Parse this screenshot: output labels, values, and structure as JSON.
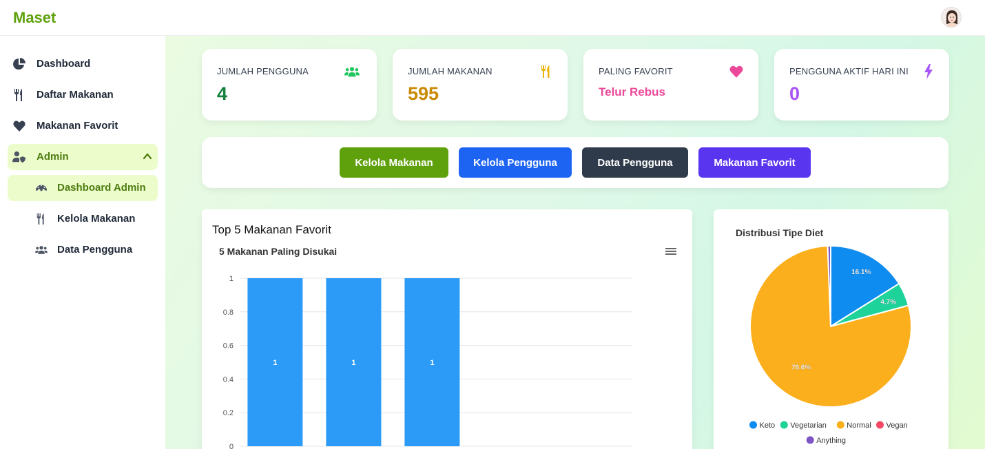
{
  "app": {
    "brand": "Maset"
  },
  "sidebar": {
    "items": [
      {
        "label": "Dashboard",
        "icon": "chart-pie-icon"
      },
      {
        "label": "Daftar Makanan",
        "icon": "utensils-icon"
      },
      {
        "label": "Makanan Favorit",
        "icon": "heart-icon"
      },
      {
        "label": "Admin",
        "icon": "user-shield-icon"
      }
    ],
    "sub_items": [
      {
        "label": "Dashboard Admin",
        "icon": "gauge-icon"
      },
      {
        "label": "Kelola Makanan",
        "icon": "utensils-icon"
      },
      {
        "label": "Data Pengguna",
        "icon": "users-icon"
      }
    ]
  },
  "stats": [
    {
      "label": "JUMLAH PENGGUNA",
      "value": "4",
      "color": "#15803d",
      "icon": "users-icon",
      "icon_color": "#22c55e"
    },
    {
      "label": "JUMLAH MAKANAN",
      "value": "595",
      "color": "#ca8a04",
      "icon": "utensils-icon",
      "icon_color": "#eab308"
    },
    {
      "label": "PALING FAVORIT",
      "value": "Telur Rebus",
      "color": "#ec4899",
      "icon": "heart-icon",
      "icon_color": "#ec4899"
    },
    {
      "label": "PENGGUNA AKTIF HARI INI",
      "value": "0",
      "color": "#a855f7",
      "icon": "bolt-icon",
      "icon_color": "#a855f7"
    }
  ],
  "actions": [
    {
      "label": "Kelola Makanan",
      "color": "#5fa10d"
    },
    {
      "label": "Kelola Pengguna",
      "color": "#1d64f2"
    },
    {
      "label": "Data Pengguna",
      "color": "#2f3a4a"
    },
    {
      "label": "Makanan Favorit",
      "color": "#5a35f0"
    }
  ],
  "bar_panel": {
    "title": "Top 5 Makanan Favorit"
  },
  "chart_data": [
    {
      "type": "bar",
      "title": "5 Makanan Paling Disukai",
      "categories": [
        "",
        "",
        "",
        "",
        ""
      ],
      "values": [
        1,
        1,
        1,
        0,
        0
      ],
      "data_labels": [
        "1",
        "1",
        "1",
        "",
        ""
      ],
      "yticks": [
        "0",
        "0.2",
        "0.4",
        "0.6",
        "0.8",
        "1"
      ],
      "ylim": [
        0,
        1
      ],
      "color": "#2b9bf7",
      "grid": true
    },
    {
      "type": "pie",
      "title": "Distribusi Tipe Diet",
      "labels": [
        "Keto",
        "Vegetarian",
        "Normal",
        "Vegan",
        "Anything"
      ],
      "values": [
        16.1,
        4.7,
        78.6,
        0.0,
        0.6
      ],
      "data_labels": [
        "16.1%",
        "4.7%",
        "78.6%",
        "",
        ""
      ],
      "colors": [
        "#0f8cf0",
        "#1ed39a",
        "#fbaf1c",
        "#f24866",
        "#7d55c7"
      ],
      "legend": "bottom"
    }
  ]
}
